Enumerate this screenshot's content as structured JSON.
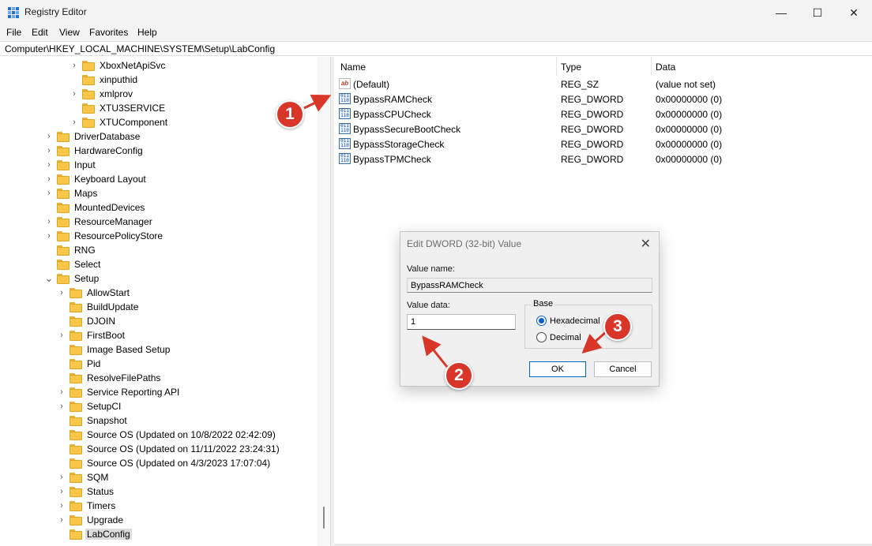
{
  "window": {
    "title": "Registry Editor",
    "minimize_glyph": "—",
    "maximize_glyph": "☐",
    "close_glyph": "✕"
  },
  "menu": [
    "File",
    "Edit",
    "View",
    "Favorites",
    "Help"
  ],
  "address": "Computer\\HKEY_LOCAL_MACHINE\\SYSTEM\\Setup\\LabConfig",
  "tree": [
    {
      "label": "XboxNetApiSvc",
      "level": 2,
      "expander": true
    },
    {
      "label": "xinputhid",
      "level": 2,
      "expander": false
    },
    {
      "label": "xmlprov",
      "level": 2,
      "expander": true
    },
    {
      "label": "XTU3SERVICE",
      "level": 2,
      "expander": false
    },
    {
      "label": "XTUComponent",
      "level": 2,
      "expander": true
    },
    {
      "label": "DriverDatabase",
      "level": 0,
      "expander": true
    },
    {
      "label": "HardwareConfig",
      "level": 0,
      "expander": true
    },
    {
      "label": "Input",
      "level": 0,
      "expander": true
    },
    {
      "label": "Keyboard Layout",
      "level": 0,
      "expander": true
    },
    {
      "label": "Maps",
      "level": 0,
      "expander": true
    },
    {
      "label": "MountedDevices",
      "level": 0,
      "expander": false
    },
    {
      "label": "ResourceManager",
      "level": 0,
      "expander": true
    },
    {
      "label": "ResourcePolicyStore",
      "level": 0,
      "expander": true
    },
    {
      "label": "RNG",
      "level": 0,
      "expander": false
    },
    {
      "label": "Select",
      "level": 0,
      "expander": false
    },
    {
      "label": "Setup",
      "level": 0,
      "expander": true,
      "expanded": true
    },
    {
      "label": "AllowStart",
      "level": 1,
      "expander": true
    },
    {
      "label": "BuildUpdate",
      "level": 1,
      "expander": false
    },
    {
      "label": "DJOIN",
      "level": 1,
      "expander": false
    },
    {
      "label": "FirstBoot",
      "level": 1,
      "expander": true
    },
    {
      "label": "Image Based Setup",
      "level": 1,
      "expander": false
    },
    {
      "label": "Pid",
      "level": 1,
      "expander": false
    },
    {
      "label": "ResolveFilePaths",
      "level": 1,
      "expander": false
    },
    {
      "label": "Service Reporting API",
      "level": 1,
      "expander": true
    },
    {
      "label": "SetupCI",
      "level": 1,
      "expander": true
    },
    {
      "label": "Snapshot",
      "level": 1,
      "expander": false
    },
    {
      "label": "Source OS (Updated on 10/8/2022 02:42:09)",
      "level": 1,
      "expander": false
    },
    {
      "label": "Source OS (Updated on 11/11/2022 23:24:31)",
      "level": 1,
      "expander": false
    },
    {
      "label": "Source OS (Updated on 4/3/2023 17:07:04)",
      "level": 1,
      "expander": false
    },
    {
      "label": "SQM",
      "level": 1,
      "expander": true
    },
    {
      "label": "Status",
      "level": 1,
      "expander": true
    },
    {
      "label": "Timers",
      "level": 1,
      "expander": true
    },
    {
      "label": "Upgrade",
      "level": 1,
      "expander": true
    },
    {
      "label": "LabConfig",
      "level": 1,
      "expander": false,
      "selected": true
    }
  ],
  "list": {
    "headers": [
      "Name",
      "Type",
      "Data"
    ],
    "rows": [
      {
        "icon": "string-value-icon",
        "name": "(Default)",
        "type": "REG_SZ",
        "data": "(value not set)"
      },
      {
        "icon": "dword-value-icon",
        "name": "BypassRAMCheck",
        "type": "REG_DWORD",
        "data": "0x00000000 (0)"
      },
      {
        "icon": "dword-value-icon",
        "name": "BypassCPUCheck",
        "type": "REG_DWORD",
        "data": "0x00000000 (0)"
      },
      {
        "icon": "dword-value-icon",
        "name": "BypassSecureBootCheck",
        "type": "REG_DWORD",
        "data": "0x00000000 (0)"
      },
      {
        "icon": "dword-value-icon",
        "name": "BypassStorageCheck",
        "type": "REG_DWORD",
        "data": "0x00000000 (0)"
      },
      {
        "icon": "dword-value-icon",
        "name": "BypassTPMCheck",
        "type": "REG_DWORD",
        "data": "0x00000000 (0)"
      }
    ]
  },
  "dialog": {
    "title": "Edit DWORD (32-bit) Value",
    "close_glyph": "✕",
    "value_name_label": "Value name:",
    "value_name": "BypassRAMCheck",
    "value_data_label": "Value data:",
    "value_data": "1",
    "base_label": "Base",
    "base_options": [
      {
        "label": "Hexadecimal",
        "checked": true
      },
      {
        "label": "Decimal",
        "checked": false
      }
    ],
    "ok_label": "OK",
    "cancel_label": "Cancel"
  },
  "annotations": [
    "1",
    "2",
    "3"
  ],
  "colors": {
    "annotation_red": "#d9362a",
    "folder_yellow": "#f8c648",
    "accent_blue": "#0067c0"
  }
}
